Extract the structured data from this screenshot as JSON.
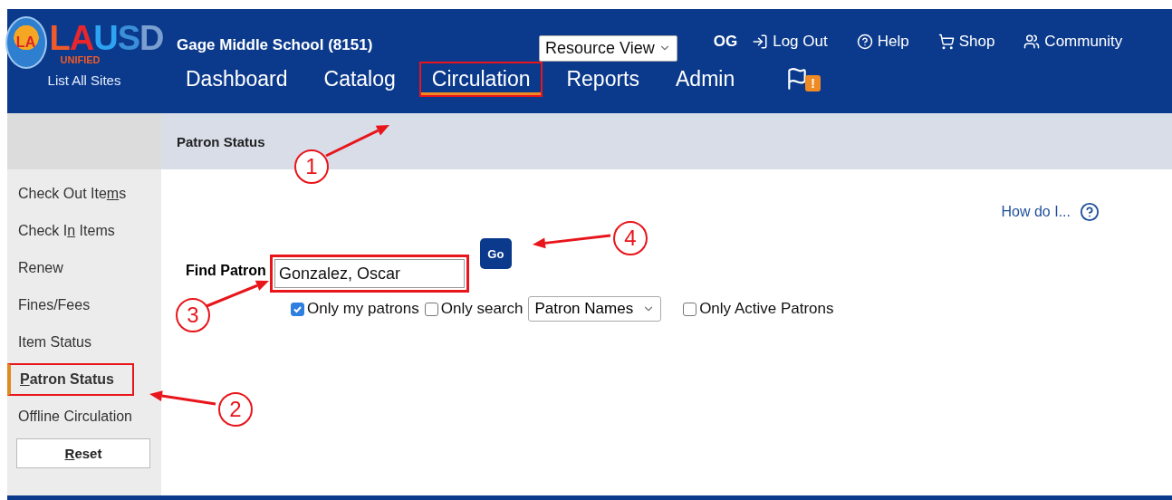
{
  "logo": {
    "emblem": "LA",
    "letters": [
      {
        "char": "L",
        "color": "#f05a28"
      },
      {
        "char": "A",
        "color": "#e8262b"
      },
      {
        "char": "U",
        "color": "#2ea3f2"
      },
      {
        "char": "S",
        "color": "#3b8fd9"
      },
      {
        "char": "D",
        "color": "#7a9fd0"
      }
    ],
    "subtitle": "UNIFIED",
    "link": "List All Sites"
  },
  "site_name": "Gage Middle School (8151)",
  "view_select": {
    "value": "Resource View"
  },
  "user_initials": "OG",
  "top_links": [
    {
      "kind": "logout",
      "label": "Log Out"
    },
    {
      "kind": "help",
      "label": "Help"
    },
    {
      "kind": "shop",
      "label": "Shop"
    },
    {
      "kind": "community",
      "label": "Community"
    }
  ],
  "nav_tabs": [
    {
      "label": "Dashboard",
      "selected": false,
      "highlighted": false
    },
    {
      "label": "Catalog",
      "selected": false,
      "highlighted": false
    },
    {
      "label": "Circulation",
      "selected": true,
      "highlighted": true
    },
    {
      "label": "Reports",
      "selected": false,
      "highlighted": false
    },
    {
      "label": "Admin",
      "selected": false,
      "highlighted": false
    }
  ],
  "alert_badge": "!",
  "breadcrumb": "Patron Status",
  "sidebar": {
    "items": [
      {
        "before": "Check Out Ite",
        "key": "m",
        "after": "s",
        "selected": false,
        "highlighted": false
      },
      {
        "before": "Check I",
        "key": "n",
        "after": " Items",
        "selected": false,
        "highlighted": false
      },
      {
        "before": "Renew",
        "selected": false,
        "highlighted": false
      },
      {
        "before": "Fines/Fees",
        "selected": false,
        "highlighted": false
      },
      {
        "before": "Item Status",
        "selected": false,
        "highlighted": false
      },
      {
        "key": "P",
        "after": "atron Status",
        "selected": true,
        "highlighted": true
      },
      {
        "before": "Offline Circulation",
        "selected": false,
        "highlighted": false
      }
    ],
    "reset_button": {
      "key": "R",
      "after": "eset"
    }
  },
  "help_link": "How do I...",
  "find_patron": {
    "label": "Find Patron",
    "value": "Gonzalez, Oscar",
    "highlighted": true,
    "go_button": "Go"
  },
  "options": [
    {
      "kind": "checkbox",
      "label": "Only my patrons",
      "checked": true
    },
    {
      "kind": "checkbox",
      "label": "Only search",
      "checked": false
    },
    {
      "kind": "select",
      "value": "Patron Names"
    },
    {
      "kind": "checkbox",
      "label": "Only Active Patrons",
      "checked": false
    }
  ],
  "callouts": [
    {
      "number": "1"
    },
    {
      "number": "2"
    },
    {
      "number": "3"
    },
    {
      "number": "4"
    }
  ]
}
